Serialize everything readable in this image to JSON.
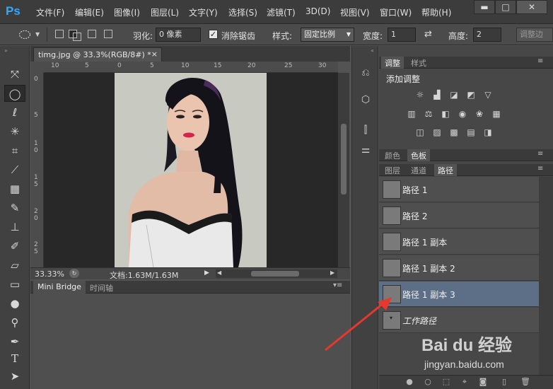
{
  "app": {
    "logo": "Ps"
  },
  "menu": [
    "文件(F)",
    "编辑(E)",
    "图像(I)",
    "图层(L)",
    "文字(Y)",
    "选择(S)",
    "滤镜(T)",
    "3D(D)",
    "视图(V)",
    "窗口(W)",
    "帮助(H)"
  ],
  "window_controls": {
    "minimize": "▬",
    "maximize": "□",
    "close": "✕"
  },
  "options": {
    "feather_label": "羽化:",
    "feather_value": "0 像素",
    "antialias_label": "消除锯齿",
    "style_label": "样式:",
    "style_value": "固定比例",
    "width_label": "宽度:",
    "width_value": "1",
    "height_label": "高度:",
    "height_value": "2",
    "adjust_edge": "调整边"
  },
  "document": {
    "tab_title": "timg.jpg @ 33.3%(RGB/8#) *",
    "tab_close": "×",
    "zoom": "33.33%",
    "doc_info": "文档:1.63M/1.63M",
    "ruler_top": [
      "10",
      "5",
      "0",
      "5",
      "10",
      "15",
      "20",
      "25",
      "30"
    ],
    "ruler_left": [
      "0",
      "5",
      "1 0",
      "1 5",
      "2 0",
      "2 5"
    ]
  },
  "bottom_panel": {
    "tabs": [
      "Mini Bridge",
      "时间轴"
    ]
  },
  "adjustments": {
    "tabs": [
      "调整",
      "样式"
    ],
    "heading": "添加调整"
  },
  "color_tabs": [
    "颜色",
    "色板"
  ],
  "layer_tabs": [
    "图层",
    "通道",
    "路径"
  ],
  "paths": [
    {
      "name": "路径 1",
      "selected": false,
      "italic": false
    },
    {
      "name": "路径 2",
      "selected": false,
      "italic": false
    },
    {
      "name": "路径 1 副本",
      "selected": false,
      "italic": false
    },
    {
      "name": "路径 1 副本 2",
      "selected": false,
      "italic": false
    },
    {
      "name": "路径 1 副本 3",
      "selected": true,
      "italic": false
    },
    {
      "name": "工作路径",
      "selected": false,
      "italic": true
    }
  ],
  "watermark": {
    "brand": "Bai du 经验",
    "url": "jingyan.baidu.com"
  },
  "colors": {
    "selected_row": "#5d6f86",
    "arrow": "#e8372c",
    "ps_blue": "#31a8ff"
  }
}
